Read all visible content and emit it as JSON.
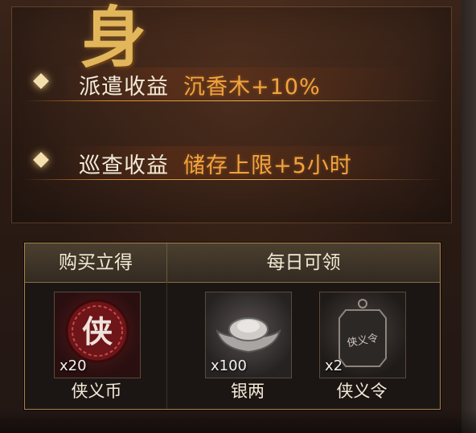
{
  "decor": {
    "char": "身"
  },
  "bonuses": [
    {
      "label": "派遣收益",
      "value": "沉香木+10%"
    },
    {
      "label": "巡查收益",
      "value": "储存上限+5小时"
    }
  ],
  "rewards": {
    "left_header": "购买立得",
    "right_header": "每日可领",
    "items": [
      {
        "name": "侠义币",
        "count": "x20",
        "icon": "xiayi-coin-icon",
        "emblem": "侠"
      },
      {
        "name": "银两",
        "count": "x100",
        "icon": "silver-ingot-icon"
      },
      {
        "name": "侠义令",
        "count": "x2",
        "icon": "xiayi-token-icon",
        "emblem": "侠义令"
      }
    ]
  },
  "colors": {
    "accent": "#f2a33c",
    "frame": "#a9834a",
    "text": "#f3ead8"
  }
}
